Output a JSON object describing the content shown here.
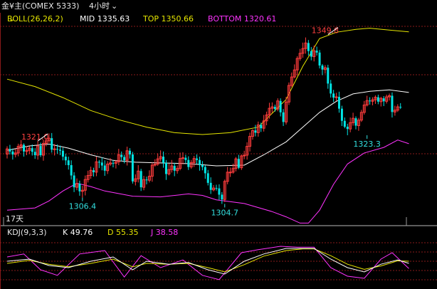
{
  "header": {
    "symbol": "金¥主(COMEX 5333)",
    "period": "4小时",
    "period_icon": "chevron-down-icon"
  },
  "boll_legend": {
    "name": "BOLL(26,26,2)",
    "mid": "MID 1335.63",
    "top": "TOP 1350.66",
    "bottom": "BOTTOM 1320.61",
    "colors": {
      "mid": "#ffffff",
      "top": "#e6e600",
      "bottom": "#ff33ff"
    }
  },
  "kdj_legend": {
    "name": "KDJ(9,3,3)",
    "k": "K 49.76",
    "d": "D 55.35",
    "j": "J 38.58",
    "colors": {
      "k": "#ffffff",
      "d": "#e6e600",
      "j": "#ff33ff"
    }
  },
  "period_days_label": "17天",
  "chart_data": {
    "type": "candlestick",
    "y_range": [
      1299,
      1353
    ],
    "colors": {
      "up": "#ff3c3c",
      "down": "#00e5e5",
      "grid": "#8a1a1a"
    },
    "annotations": [
      {
        "label": "1321.0",
        "x": 10,
        "y": 1321.0,
        "color": "#ff4040"
      },
      {
        "label": "1306.4",
        "x": 27,
        "y": 1306.4,
        "color": "#33e0e0"
      },
      {
        "label": "1304.7",
        "x": 78,
        "y": 1304.7,
        "color": "#33e0e0"
      },
      {
        "label": "1349.8",
        "x": 114,
        "y": 1349.8,
        "color": "#ff4040"
      },
      {
        "label": "1323.3",
        "x": 129,
        "y": 1323.3,
        "color": "#33e0e0"
      }
    ],
    "candles": [
      [
        1318.2,
        1319.6,
        1317.0,
        1320.3
      ],
      [
        1319.6,
        1318.9,
        1318.1,
        1320.7
      ],
      [
        1318.9,
        1318.1,
        1316.7,
        1319.7
      ],
      [
        1318.1,
        1318.5,
        1317.3,
        1319.6
      ],
      [
        1318.5,
        1320.3,
        1317.6,
        1321.0
      ],
      [
        1320.3,
        1320.7,
        1319.0,
        1322.0
      ],
      [
        1320.7,
        1318.9,
        1317.5,
        1321.1
      ],
      [
        1318.9,
        1319.2,
        1317.9,
        1320.3
      ],
      [
        1319.2,
        1319.8,
        1318.2,
        1320.3
      ],
      [
        1319.8,
        1318.8,
        1317.8,
        1320.8
      ],
      [
        1318.8,
        1317.9,
        1316.9,
        1319.8
      ],
      [
        1317.9,
        1320.4,
        1316.7,
        1321.8
      ],
      [
        1320.4,
        1317.9,
        1317.4,
        1321.3
      ],
      [
        1317.9,
        1321.1,
        1316.4,
        1322.1
      ],
      [
        1321.1,
        1321.8,
        1320.3,
        1322.6
      ],
      [
        1321.8,
        1322.5,
        1321.2,
        1323.8
      ],
      [
        1322.5,
        1319.4,
        1318.6,
        1323.9
      ],
      [
        1319.4,
        1319.6,
        1317.8,
        1320.9
      ],
      [
        1319.6,
        1319.4,
        1318.3,
        1320.8
      ],
      [
        1319.4,
        1319.1,
        1317.9,
        1320.5
      ],
      [
        1319.1,
        1317.5,
        1316.5,
        1319.9
      ],
      [
        1317.5,
        1316.5,
        1315.2,
        1318.3
      ],
      [
        1316.5,
        1315.2,
        1314.0,
        1317.5
      ],
      [
        1315.2,
        1312.4,
        1311.3,
        1316.5
      ],
      [
        1312.4,
        1309.2,
        1307.9,
        1313.3
      ],
      [
        1309.2,
        1310.2,
        1308.4,
        1311.6
      ],
      [
        1310.2,
        1308.1,
        1306.9,
        1311.0
      ],
      [
        1308.1,
        1308.4,
        1306.4,
        1309.6
      ],
      [
        1308.4,
        1311.3,
        1307.0,
        1312.4
      ],
      [
        1311.3,
        1312.4,
        1310.5,
        1313.7
      ],
      [
        1312.4,
        1313.8,
        1311.5,
        1314.8
      ],
      [
        1313.8,
        1313.3,
        1312.1,
        1314.5
      ],
      [
        1313.3,
        1316.1,
        1312.2,
        1317.5
      ],
      [
        1316.1,
        1315.9,
        1314.4,
        1316.6
      ],
      [
        1315.9,
        1315.1,
        1313.8,
        1317.3
      ],
      [
        1315.1,
        1313.7,
        1312.3,
        1316.5
      ],
      [
        1313.7,
        1315.5,
        1312.8,
        1316.3
      ],
      [
        1315.5,
        1315.8,
        1315.0,
        1317.1
      ],
      [
        1315.8,
        1315.7,
        1314.6,
        1316.5
      ],
      [
        1315.7,
        1316.1,
        1314.3,
        1316.6
      ],
      [
        1316.1,
        1318.0,
        1315.2,
        1319.6
      ],
      [
        1318.0,
        1317.4,
        1316.3,
        1318.9
      ],
      [
        1317.4,
        1316.5,
        1315.7,
        1318.0
      ],
      [
        1316.5,
        1319.1,
        1315.1,
        1320.2
      ],
      [
        1319.1,
        1318.1,
        1317.0,
        1319.8
      ],
      [
        1318.1,
        1310.8,
        1310.2,
        1318.8
      ],
      [
        1310.8,
        1311.5,
        1309.7,
        1312.7
      ],
      [
        1311.5,
        1313.6,
        1310.5,
        1315.2
      ],
      [
        1313.6,
        1309.2,
        1308.2,
        1314.2
      ],
      [
        1309.2,
        1311.3,
        1308.4,
        1312.3
      ],
      [
        1311.3,
        1311.1,
        1310.0,
        1312.1
      ],
      [
        1311.1,
        1312.2,
        1310.5,
        1313.8
      ],
      [
        1312.2,
        1315.2,
        1310.7,
        1315.9
      ],
      [
        1315.2,
        1315.5,
        1314.8,
        1316.8
      ],
      [
        1315.5,
        1316.9,
        1315.0,
        1318.4
      ],
      [
        1316.9,
        1317.5,
        1316.1,
        1319.2
      ],
      [
        1317.5,
        1315.8,
        1314.5,
        1318.9
      ],
      [
        1315.8,
        1312.8,
        1311.2,
        1316.6
      ],
      [
        1312.8,
        1314.0,
        1312.4,
        1315.6
      ],
      [
        1314.0,
        1315.0,
        1313.2,
        1316.6
      ],
      [
        1315.0,
        1313.7,
        1312.2,
        1315.8
      ],
      [
        1313.7,
        1314.3,
        1312.9,
        1315.1
      ],
      [
        1314.3,
        1317.0,
        1313.8,
        1318.6
      ],
      [
        1317.0,
        1317.2,
        1315.4,
        1318.7
      ],
      [
        1317.2,
        1316.6,
        1315.8,
        1318.0
      ],
      [
        1316.6,
        1314.7,
        1313.9,
        1317.6
      ],
      [
        1314.7,
        1315.9,
        1314.2,
        1316.6
      ],
      [
        1315.9,
        1317.0,
        1314.7,
        1317.7
      ],
      [
        1317.0,
        1316.6,
        1315.5,
        1318.1
      ],
      [
        1316.6,
        1315.2,
        1313.7,
        1317.5
      ],
      [
        1315.2,
        1314.7,
        1313.8,
        1316.3
      ],
      [
        1314.7,
        1313.0,
        1311.5,
        1315.2
      ],
      [
        1313.0,
        1310.4,
        1309.7,
        1313.9
      ],
      [
        1310.4,
        1308.5,
        1307.4,
        1311.9
      ],
      [
        1308.5,
        1309.0,
        1308.1,
        1309.8
      ],
      [
        1309.0,
        1308.9,
        1308.3,
        1309.9
      ],
      [
        1308.9,
        1307.2,
        1305.8,
        1310.0
      ],
      [
        1307.2,
        1305.9,
        1304.7,
        1307.9
      ],
      [
        1305.9,
        1310.8,
        1305.2,
        1311.3
      ],
      [
        1310.8,
        1313.3,
        1310.0,
        1314.7
      ],
      [
        1313.3,
        1313.3,
        1312.0,
        1314.5
      ],
      [
        1313.3,
        1314.3,
        1312.9,
        1315.6
      ],
      [
        1314.3,
        1316.9,
        1313.5,
        1317.4
      ],
      [
        1316.9,
        1314.5,
        1314.1,
        1318.0
      ],
      [
        1314.5,
        1317.7,
        1313.9,
        1318.1
      ],
      [
        1317.7,
        1317.9,
        1316.8,
        1319.1
      ],
      [
        1317.9,
        1320.3,
        1316.7,
        1321.4
      ],
      [
        1320.3,
        1323.0,
        1318.9,
        1324.0
      ],
      [
        1323.0,
        1324.6,
        1322.1,
        1324.9
      ],
      [
        1324.6,
        1324.0,
        1323.0,
        1326.1
      ],
      [
        1324.0,
        1326.1,
        1322.9,
        1327.0
      ],
      [
        1326.1,
        1325.2,
        1324.2,
        1326.7
      ],
      [
        1325.2,
        1327.2,
        1324.3,
        1328.8
      ],
      [
        1327.2,
        1328.8,
        1326.0,
        1329.7
      ],
      [
        1328.8,
        1330.6,
        1327.8,
        1332.1
      ],
      [
        1330.6,
        1331.0,
        1329.4,
        1332.2
      ],
      [
        1331.0,
        1330.4,
        1329.7,
        1331.6
      ],
      [
        1330.4,
        1332.6,
        1329.8,
        1333.3
      ],
      [
        1332.6,
        1329.5,
        1328.4,
        1333.3
      ],
      [
        1329.5,
        1326.9,
        1325.8,
        1330.4
      ],
      [
        1326.9,
        1332.3,
        1326.2,
        1333.7
      ],
      [
        1332.3,
        1336.8,
        1331.5,
        1337.6
      ],
      [
        1336.8,
        1339.1,
        1336.3,
        1340.3
      ],
      [
        1339.1,
        1341.0,
        1338.7,
        1342.5
      ],
      [
        1341.0,
        1344.1,
        1339.5,
        1344.7
      ],
      [
        1344.1,
        1345.5,
        1343.5,
        1346.7
      ],
      [
        1345.5,
        1346.8,
        1344.3,
        1348.4
      ],
      [
        1346.8,
        1348.3,
        1345.4,
        1349.8
      ],
      [
        1348.3,
        1346.1,
        1344.9,
        1349.1
      ],
      [
        1346.1,
        1344.6,
        1343.6,
        1347.2
      ],
      [
        1344.6,
        1346.2,
        1343.3,
        1347.6
      ],
      [
        1346.2,
        1345.7,
        1344.9,
        1347.3
      ],
      [
        1345.7,
        1342.2,
        1341.4,
        1346.4
      ],
      [
        1342.2,
        1341.1,
        1339.6,
        1342.6
      ],
      [
        1341.1,
        1341.6,
        1340.0,
        1342.3
      ],
      [
        1341.6,
        1337.3,
        1335.9,
        1342.4
      ],
      [
        1337.3,
        1334.6,
        1333.5,
        1338.3
      ],
      [
        1334.6,
        1333.5,
        1332.3,
        1335.6
      ],
      [
        1333.5,
        1333.7,
        1332.6,
        1334.8
      ],
      [
        1333.7,
        1330.5,
        1329.4,
        1335.1
      ],
      [
        1330.5,
        1327.2,
        1325.8,
        1331.3
      ],
      [
        1327.2,
        1325.6,
        1325.2,
        1328.1
      ],
      [
        1325.6,
        1325.0,
        1323.3,
        1326.4
      ],
      [
        1325.0,
        1326.7,
        1324.1,
        1328.1
      ],
      [
        1326.7,
        1327.9,
        1325.9,
        1329.4
      ],
      [
        1327.9,
        1325.9,
        1324.9,
        1328.4
      ],
      [
        1325.9,
        1327.4,
        1324.5,
        1328.0
      ],
      [
        1327.4,
        1329.5,
        1326.9,
        1330.2
      ],
      [
        1329.5,
        1331.5,
        1328.9,
        1332.6
      ],
      [
        1331.5,
        1332.7,
        1331.1,
        1334.0
      ],
      [
        1332.7,
        1332.5,
        1331.6,
        1333.6
      ],
      [
        1332.5,
        1332.9,
        1331.4,
        1333.6
      ],
      [
        1332.9,
        1333.6,
        1331.8,
        1334.1
      ],
      [
        1333.6,
        1332.4,
        1331.7,
        1334.3
      ],
      [
        1332.4,
        1333.3,
        1331.1,
        1333.7
      ],
      [
        1333.3,
        1332.5,
        1331.2,
        1333.9
      ],
      [
        1332.5,
        1333.7,
        1331.9,
        1334.3
      ],
      [
        1333.7,
        1334.0,
        1332.7,
        1334.6
      ],
      [
        1334.0,
        1329.6,
        1328.1,
        1334.9
      ],
      [
        1329.6,
        1330.1,
        1328.6,
        1331.3
      ],
      [
        1330.1,
        1331.0,
        1329.6,
        1331.7
      ],
      [
        1331.0,
        1330.9,
        1330.4,
        1332.0
      ]
    ],
    "boll_top": [
      [
        0,
        1338.5
      ],
      [
        10,
        1336.5
      ],
      [
        20,
        1333.5
      ],
      [
        30,
        1330.0
      ],
      [
        40,
        1327.5
      ],
      [
        50,
        1325.5
      ],
      [
        60,
        1324.0
      ],
      [
        70,
        1323.5
      ],
      [
        80,
        1324.0
      ],
      [
        90,
        1325.5
      ],
      [
        100,
        1333.0
      ],
      [
        106,
        1342.0
      ],
      [
        112,
        1349.5
      ],
      [
        118,
        1351.2
      ],
      [
        125,
        1352.0
      ],
      [
        130,
        1352.3
      ],
      [
        137,
        1351.8
      ],
      [
        144,
        1351.3
      ]
    ],
    "boll_mid": [
      [
        0,
        1319.2
      ],
      [
        8,
        1320.4
      ],
      [
        15,
        1320.9
      ],
      [
        22,
        1319.8
      ],
      [
        30,
        1318.0
      ],
      [
        38,
        1316.5
      ],
      [
        46,
        1316.0
      ],
      [
        55,
        1315.8
      ],
      [
        65,
        1315.6
      ],
      [
        75,
        1315.0
      ],
      [
        85,
        1315.2
      ],
      [
        92,
        1318.0
      ],
      [
        100,
        1321.5
      ],
      [
        106,
        1325.5
      ],
      [
        112,
        1329.5
      ],
      [
        118,
        1332.5
      ],
      [
        124,
        1334.5
      ],
      [
        130,
        1335.2
      ],
      [
        137,
        1335.6
      ],
      [
        144,
        1334.9
      ]
    ],
    "boll_bottom": [
      [
        0,
        1303.0
      ],
      [
        10,
        1303.6
      ],
      [
        15,
        1305.5
      ],
      [
        20,
        1308.2
      ],
      [
        25,
        1310.3
      ],
      [
        30,
        1309.4
      ],
      [
        35,
        1308.2
      ],
      [
        45,
        1306.8
      ],
      [
        55,
        1306.6
      ],
      [
        65,
        1307.4
      ],
      [
        70,
        1307.0
      ],
      [
        75,
        1305.8
      ],
      [
        85,
        1304.8
      ],
      [
        95,
        1302.6
      ],
      [
        100,
        1301.2
      ],
      [
        105,
        1299.5
      ],
      [
        108,
        1299.5
      ],
      [
        112,
        1303.0
      ],
      [
        117,
        1310.0
      ],
      [
        122,
        1315.5
      ],
      [
        128,
        1318.5
      ],
      [
        135,
        1320.0
      ],
      [
        140,
        1322.0
      ],
      [
        144,
        1321.0
      ]
    ],
    "kdj": {
      "y_range": [
        0,
        100
      ],
      "k": [
        [
          0,
          55
        ],
        [
          8,
          60
        ],
        [
          15,
          45
        ],
        [
          22,
          40
        ],
        [
          30,
          55
        ],
        [
          38,
          65
        ],
        [
          45,
          35
        ],
        [
          50,
          55
        ],
        [
          58,
          48
        ],
        [
          65,
          52
        ],
        [
          72,
          35
        ],
        [
          78,
          25
        ],
        [
          85,
          55
        ],
        [
          92,
          72
        ],
        [
          100,
          85
        ],
        [
          106,
          85
        ],
        [
          110,
          85
        ],
        [
          116,
          60
        ],
        [
          122,
          40
        ],
        [
          128,
          30
        ],
        [
          134,
          48
        ],
        [
          140,
          58
        ],
        [
          144,
          50
        ]
      ],
      "d": [
        [
          0,
          50
        ],
        [
          8,
          57
        ],
        [
          15,
          48
        ],
        [
          22,
          42
        ],
        [
          30,
          50
        ],
        [
          38,
          60
        ],
        [
          45,
          42
        ],
        [
          50,
          50
        ],
        [
          58,
          48
        ],
        [
          65,
          50
        ],
        [
          72,
          40
        ],
        [
          78,
          30
        ],
        [
          85,
          47
        ],
        [
          92,
          67
        ],
        [
          100,
          80
        ],
        [
          106,
          84
        ],
        [
          110,
          84
        ],
        [
          116,
          68
        ],
        [
          122,
          48
        ],
        [
          128,
          36
        ],
        [
          134,
          44
        ],
        [
          140,
          56
        ],
        [
          144,
          55
        ]
      ],
      "j": [
        [
          0,
          65
        ],
        [
          6,
          72
        ],
        [
          12,
          35
        ],
        [
          18,
          22
        ],
        [
          26,
          72
        ],
        [
          35,
          80
        ],
        [
          42,
          18
        ],
        [
          48,
          68
        ],
        [
          55,
          40
        ],
        [
          63,
          58
        ],
        [
          70,
          22
        ],
        [
          76,
          12
        ],
        [
          84,
          75
        ],
        [
          90,
          82
        ],
        [
          98,
          90
        ],
        [
          104,
          88
        ],
        [
          110,
          88
        ],
        [
          116,
          40
        ],
        [
          122,
          20
        ],
        [
          128,
          15
        ],
        [
          134,
          60
        ],
        [
          138,
          75
        ],
        [
          144,
          38
        ]
      ]
    }
  }
}
